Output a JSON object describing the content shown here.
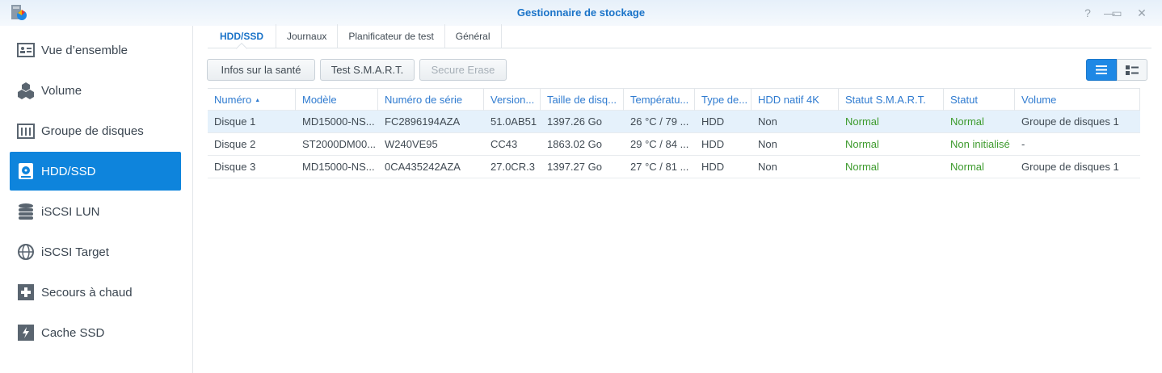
{
  "window": {
    "title": "Gestionnaire de stockage",
    "controls": [
      "?",
      "—",
      "▭",
      "✕"
    ]
  },
  "sidebar": {
    "items": [
      {
        "label": "Vue d’ensemble",
        "icon": "overview-icon"
      },
      {
        "label": "Volume",
        "icon": "cubes-icon"
      },
      {
        "label": "Groupe de disques",
        "icon": "disk-group-icon"
      },
      {
        "label": "HDD/SSD",
        "icon": "hdd-icon",
        "selected": true
      },
      {
        "label": "iSCSI LUN",
        "icon": "database-icon"
      },
      {
        "label": "iSCSI Target",
        "icon": "globe-icon"
      },
      {
        "label": "Secours à chaud",
        "icon": "plus-icon"
      },
      {
        "label": "Cache SSD",
        "icon": "ssd-cache-icon"
      }
    ]
  },
  "tabs": [
    "HDD/SSD",
    "Journaux",
    "Planificateur de test",
    "Général"
  ],
  "toolbar": {
    "health": "Infos sur la santé",
    "smart": "Test S.M.A.R.T.",
    "erase": "Secure Erase"
  },
  "table": {
    "columns": [
      "Numéro",
      "Modèle",
      "Numéro de série",
      "Version...",
      "Taille de disq...",
      "Températu...",
      "Type de...",
      "HDD natif 4K",
      "Statut S.M.A.R.T.",
      "Statut",
      "Volume"
    ],
    "sort_indicator": "▲",
    "rows": [
      [
        "Disque 1",
        "MD15000-NS...",
        "FC2896194AZA",
        "51.0AB51",
        "1397.26 Go",
        "26 °C / 79 ...",
        "HDD",
        "Non",
        "Normal",
        "Normal",
        "Groupe de disques 1"
      ],
      [
        "Disque 2",
        "ST2000DM00...",
        "W240VE95",
        "CC43",
        "1863.02 Go",
        "29 °C / 84 ...",
        "HDD",
        "Non",
        "Normal",
        "Non initialisé",
        "-"
      ],
      [
        "Disque 3",
        "MD15000-NS...",
        "0CA435242AZA",
        "27.0CR.3",
        "1397.27 Go",
        "27 °C / 81 ...",
        "HDD",
        "Non",
        "Normal",
        "Normal",
        "Groupe de disques 1"
      ]
    ]
  },
  "colors": {
    "accent": "#0e84dc",
    "status_ok": "#3c9a2c",
    "header_text": "#2f7bd0"
  }
}
